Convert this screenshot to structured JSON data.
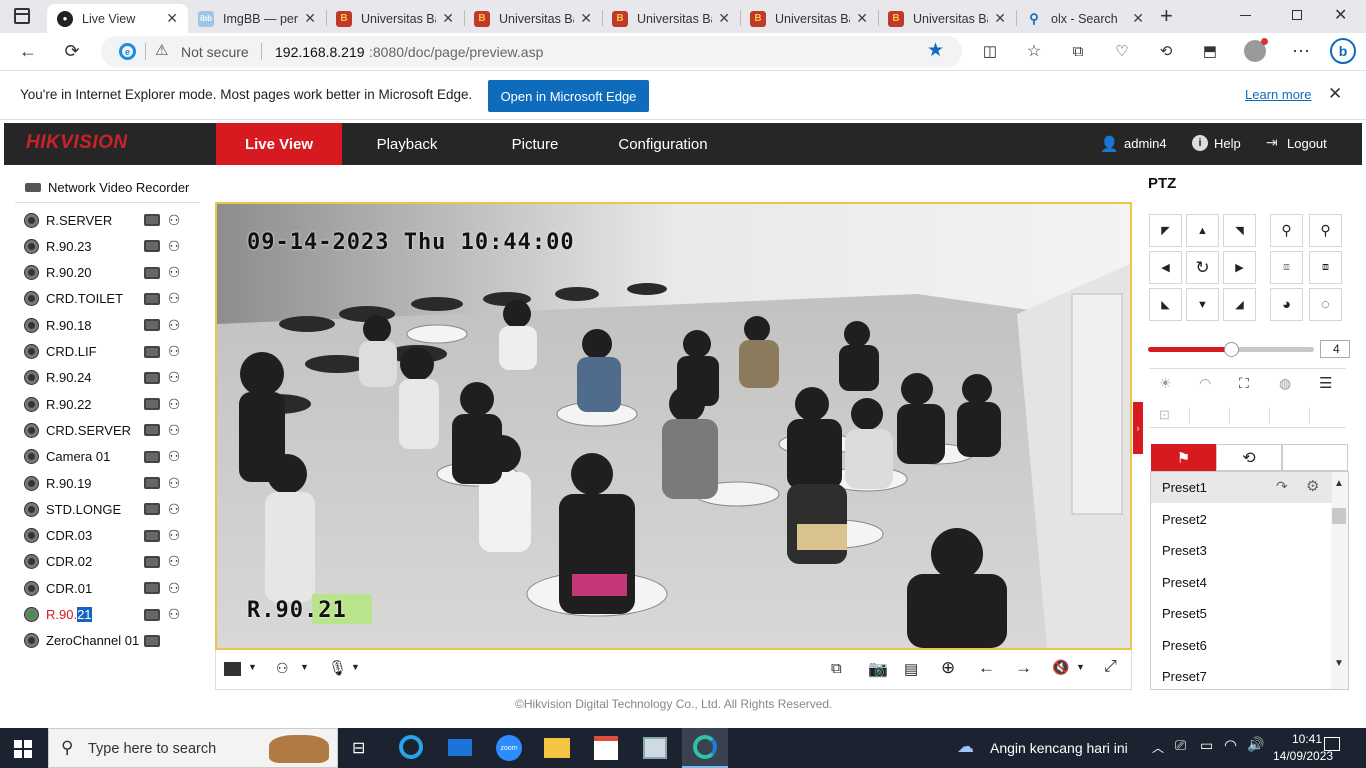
{
  "browser": {
    "tabs": [
      {
        "title": "Live View",
        "favicon": "hikvision-icon",
        "active": true
      },
      {
        "title": "ImgBB — per",
        "favicon": "imgbb-icon"
      },
      {
        "title": "Universitas Ba",
        "favicon": "university-icon"
      },
      {
        "title": "Universitas Ba",
        "favicon": "university-icon"
      },
      {
        "title": "Universitas Ba",
        "favicon": "university-icon"
      },
      {
        "title": "Universitas Ba",
        "favicon": "university-icon"
      },
      {
        "title": "Universitas Ba",
        "favicon": "university-icon"
      },
      {
        "title": "olx - Search",
        "favicon": "search-icon"
      }
    ],
    "not_secure": "Not secure",
    "url_host": "192.168.8.219",
    "url_rest": ":8080/doc/page/preview.asp",
    "ie_message": "You're in Internet Explorer mode. Most pages work better in Microsoft Edge.",
    "ie_button": "Open in Microsoft Edge",
    "ie_learn": "Learn more"
  },
  "header": {
    "logo": "HIKVISION",
    "menus": [
      "Live View",
      "Playback",
      "Picture",
      "Configuration"
    ],
    "active_menu": "Live View",
    "user": "admin4",
    "help": "Help",
    "logout": "Logout"
  },
  "tree": {
    "root": "Network Video Recorder",
    "cameras": [
      {
        "name": "R.SERVER"
      },
      {
        "name": "R.90.23"
      },
      {
        "name": "R.90.20"
      },
      {
        "name": "CRD.TOILET"
      },
      {
        "name": "R.90.18"
      },
      {
        "name": "CRD.LIF"
      },
      {
        "name": "R.90.24"
      },
      {
        "name": "R.90.22"
      },
      {
        "name": "CRD.SERVER"
      },
      {
        "name": "Camera 01"
      },
      {
        "name": "R.90.19"
      },
      {
        "name": "STD.LONGE"
      },
      {
        "name": "CDR.03"
      },
      {
        "name": "CDR.02"
      },
      {
        "name": "CDR.01"
      },
      {
        "name_prefix": "R.90.",
        "name_selected": "21",
        "active": true
      },
      {
        "name": "ZeroChannel 01"
      }
    ]
  },
  "video": {
    "timestamp": "09-14-2023 Thu 10:44:00",
    "camera_label": "R.90.21"
  },
  "ptz": {
    "title": "PTZ",
    "speed": "4",
    "speed_fraction": 0.5,
    "presets": [
      "Preset1",
      "Preset2",
      "Preset3",
      "Preset4",
      "Preset5",
      "Preset6",
      "Preset7"
    ]
  },
  "footer": {
    "copyright": "©Hikvision Digital Technology Co., Ltd. All Rights Reserved."
  },
  "taskbar": {
    "search_placeholder": "Type here to search",
    "weather": "Angin kencang hari ini",
    "time": "10:41",
    "date": "14/09/2023"
  },
  "colors": {
    "accent_red": "#d71920",
    "edge_blue": "#0f6cbd",
    "header_bg": "#262626",
    "taskbar_bg": "#1c2330"
  }
}
